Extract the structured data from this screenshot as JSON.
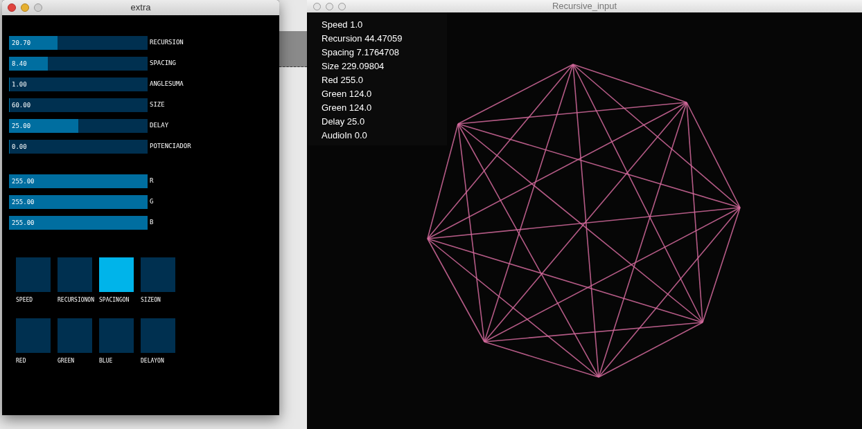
{
  "control_window": {
    "title": "extra",
    "sliders": [
      {
        "value": "20.70",
        "label": "RECURSION",
        "level": 0.35
      },
      {
        "value": "8.40",
        "label": "SPACING",
        "level": 0.28
      },
      {
        "value": "1.00",
        "label": "ANGLESUMA",
        "level": 0
      },
      {
        "value": "60.00",
        "label": "SIZE",
        "level": 0
      },
      {
        "value": "25.00",
        "label": "DELAY",
        "level": 0.5
      },
      {
        "value": "0.00",
        "label": "POTENCIADOR",
        "level": 0
      }
    ],
    "color_sliders": [
      {
        "value": "255.00",
        "label": "R",
        "level": 1
      },
      {
        "value": "255.00",
        "label": "G",
        "level": 1
      },
      {
        "value": "255.00",
        "label": "B",
        "level": 1
      }
    ],
    "toggles": [
      {
        "label": "SPEED",
        "on": false
      },
      {
        "label": "RECURSIONON",
        "on": false
      },
      {
        "label": "SPACINGON",
        "on": true
      },
      {
        "label": "SIZEON",
        "on": false
      },
      {
        "label": "RED",
        "on": false
      },
      {
        "label": "GREEN",
        "on": false
      },
      {
        "label": "BLUE",
        "on": false
      },
      {
        "label": "DELAYON",
        "on": false
      }
    ]
  },
  "output_window": {
    "title": "Recursive_input",
    "readouts": [
      "Speed 1.0",
      "Recursion 44.47059",
      "Spacing 7.1764708",
      "Size 229.09804",
      "Red 255.0",
      "Green 124.0",
      "Green 124.0",
      "Delay 25.0",
      "AudioIn 0.0"
    ]
  }
}
